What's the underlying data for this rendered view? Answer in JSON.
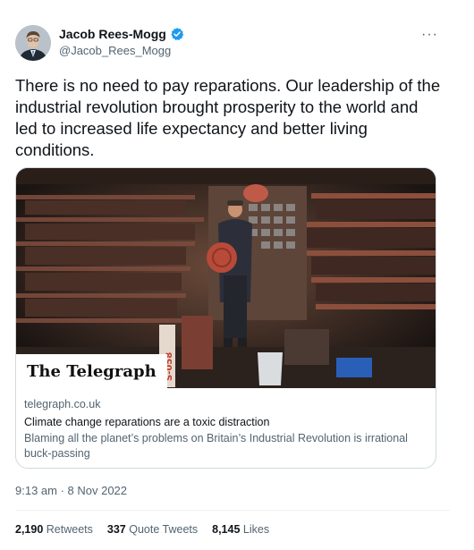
{
  "author": {
    "display_name": "Jacob Rees-Mogg",
    "handle": "@Jacob_Rees_Mogg",
    "verified_icon": "verified-badge-icon",
    "verified_color": "#1d9bf0"
  },
  "more_label": "···",
  "tweet": {
    "text": "There is no need to pay reparations. Our leadership of the industrial revolution brought prosperity to the world and led to increased life expectancy and better living conditions."
  },
  "card": {
    "brand_label": "The Telegraph",
    "image_sign_text": "S-058",
    "domain": "telegraph.co.uk",
    "title": "Climate change reparations are a toxic distraction",
    "description": "Blaming all the planet’s problems on Britain’s Industrial Revolution is irrational buck-passing"
  },
  "timestamp": "9:13 am · 8 Nov 2022",
  "stats": {
    "retweets_count": "2,190",
    "retweets_label": "Retweets",
    "quotes_count": "337",
    "quotes_label": "Quote Tweets",
    "likes_count": "8,145",
    "likes_label": "Likes"
  }
}
